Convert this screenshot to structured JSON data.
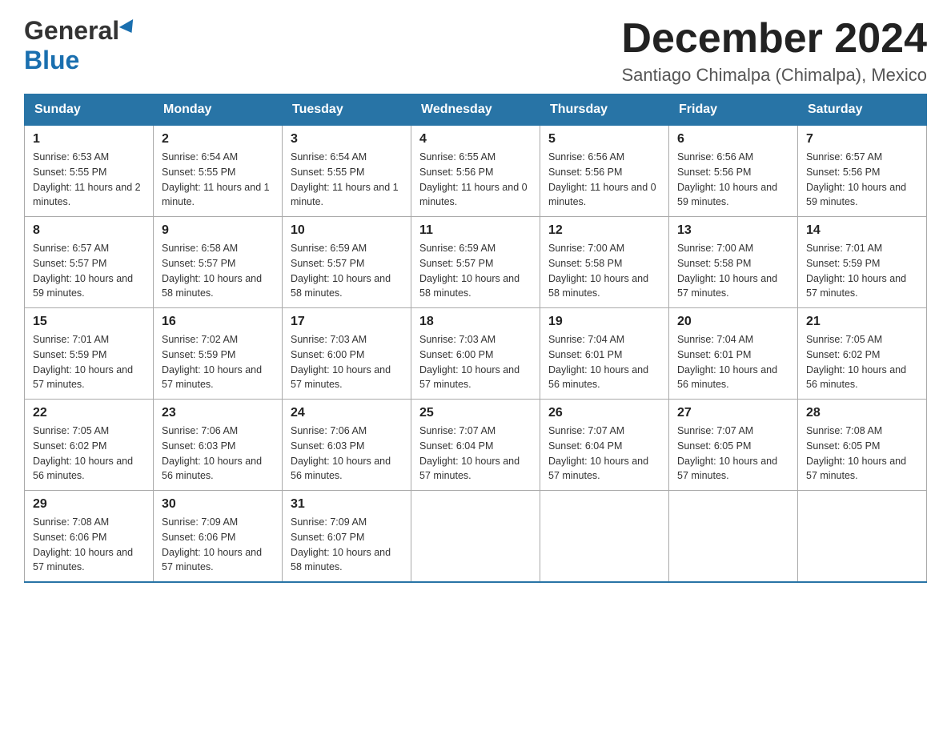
{
  "header": {
    "logo_general": "General",
    "logo_blue": "Blue",
    "month_title": "December 2024",
    "subtitle": "Santiago Chimalpa (Chimalpa), Mexico"
  },
  "weekdays": [
    "Sunday",
    "Monday",
    "Tuesday",
    "Wednesday",
    "Thursday",
    "Friday",
    "Saturday"
  ],
  "weeks": [
    [
      {
        "day": "1",
        "sunrise": "6:53 AM",
        "sunset": "5:55 PM",
        "daylight": "11 hours and 2 minutes."
      },
      {
        "day": "2",
        "sunrise": "6:54 AM",
        "sunset": "5:55 PM",
        "daylight": "11 hours and 1 minute."
      },
      {
        "day": "3",
        "sunrise": "6:54 AM",
        "sunset": "5:55 PM",
        "daylight": "11 hours and 1 minute."
      },
      {
        "day": "4",
        "sunrise": "6:55 AM",
        "sunset": "5:56 PM",
        "daylight": "11 hours and 0 minutes."
      },
      {
        "day": "5",
        "sunrise": "6:56 AM",
        "sunset": "5:56 PM",
        "daylight": "11 hours and 0 minutes."
      },
      {
        "day": "6",
        "sunrise": "6:56 AM",
        "sunset": "5:56 PM",
        "daylight": "10 hours and 59 minutes."
      },
      {
        "day": "7",
        "sunrise": "6:57 AM",
        "sunset": "5:56 PM",
        "daylight": "10 hours and 59 minutes."
      }
    ],
    [
      {
        "day": "8",
        "sunrise": "6:57 AM",
        "sunset": "5:57 PM",
        "daylight": "10 hours and 59 minutes."
      },
      {
        "day": "9",
        "sunrise": "6:58 AM",
        "sunset": "5:57 PM",
        "daylight": "10 hours and 58 minutes."
      },
      {
        "day": "10",
        "sunrise": "6:59 AM",
        "sunset": "5:57 PM",
        "daylight": "10 hours and 58 minutes."
      },
      {
        "day": "11",
        "sunrise": "6:59 AM",
        "sunset": "5:57 PM",
        "daylight": "10 hours and 58 minutes."
      },
      {
        "day": "12",
        "sunrise": "7:00 AM",
        "sunset": "5:58 PM",
        "daylight": "10 hours and 58 minutes."
      },
      {
        "day": "13",
        "sunrise": "7:00 AM",
        "sunset": "5:58 PM",
        "daylight": "10 hours and 57 minutes."
      },
      {
        "day": "14",
        "sunrise": "7:01 AM",
        "sunset": "5:59 PM",
        "daylight": "10 hours and 57 minutes."
      }
    ],
    [
      {
        "day": "15",
        "sunrise": "7:01 AM",
        "sunset": "5:59 PM",
        "daylight": "10 hours and 57 minutes."
      },
      {
        "day": "16",
        "sunrise": "7:02 AM",
        "sunset": "5:59 PM",
        "daylight": "10 hours and 57 minutes."
      },
      {
        "day": "17",
        "sunrise": "7:03 AM",
        "sunset": "6:00 PM",
        "daylight": "10 hours and 57 minutes."
      },
      {
        "day": "18",
        "sunrise": "7:03 AM",
        "sunset": "6:00 PM",
        "daylight": "10 hours and 57 minutes."
      },
      {
        "day": "19",
        "sunrise": "7:04 AM",
        "sunset": "6:01 PM",
        "daylight": "10 hours and 56 minutes."
      },
      {
        "day": "20",
        "sunrise": "7:04 AM",
        "sunset": "6:01 PM",
        "daylight": "10 hours and 56 minutes."
      },
      {
        "day": "21",
        "sunrise": "7:05 AM",
        "sunset": "6:02 PM",
        "daylight": "10 hours and 56 minutes."
      }
    ],
    [
      {
        "day": "22",
        "sunrise": "7:05 AM",
        "sunset": "6:02 PM",
        "daylight": "10 hours and 56 minutes."
      },
      {
        "day": "23",
        "sunrise": "7:06 AM",
        "sunset": "6:03 PM",
        "daylight": "10 hours and 56 minutes."
      },
      {
        "day": "24",
        "sunrise": "7:06 AM",
        "sunset": "6:03 PM",
        "daylight": "10 hours and 56 minutes."
      },
      {
        "day": "25",
        "sunrise": "7:07 AM",
        "sunset": "6:04 PM",
        "daylight": "10 hours and 57 minutes."
      },
      {
        "day": "26",
        "sunrise": "7:07 AM",
        "sunset": "6:04 PM",
        "daylight": "10 hours and 57 minutes."
      },
      {
        "day": "27",
        "sunrise": "7:07 AM",
        "sunset": "6:05 PM",
        "daylight": "10 hours and 57 minutes."
      },
      {
        "day": "28",
        "sunrise": "7:08 AM",
        "sunset": "6:05 PM",
        "daylight": "10 hours and 57 minutes."
      }
    ],
    [
      {
        "day": "29",
        "sunrise": "7:08 AM",
        "sunset": "6:06 PM",
        "daylight": "10 hours and 57 minutes."
      },
      {
        "day": "30",
        "sunrise": "7:09 AM",
        "sunset": "6:06 PM",
        "daylight": "10 hours and 57 minutes."
      },
      {
        "day": "31",
        "sunrise": "7:09 AM",
        "sunset": "6:07 PM",
        "daylight": "10 hours and 58 minutes."
      },
      null,
      null,
      null,
      null
    ]
  ],
  "labels": {
    "sunrise": "Sunrise:",
    "sunset": "Sunset:",
    "daylight": "Daylight:"
  }
}
